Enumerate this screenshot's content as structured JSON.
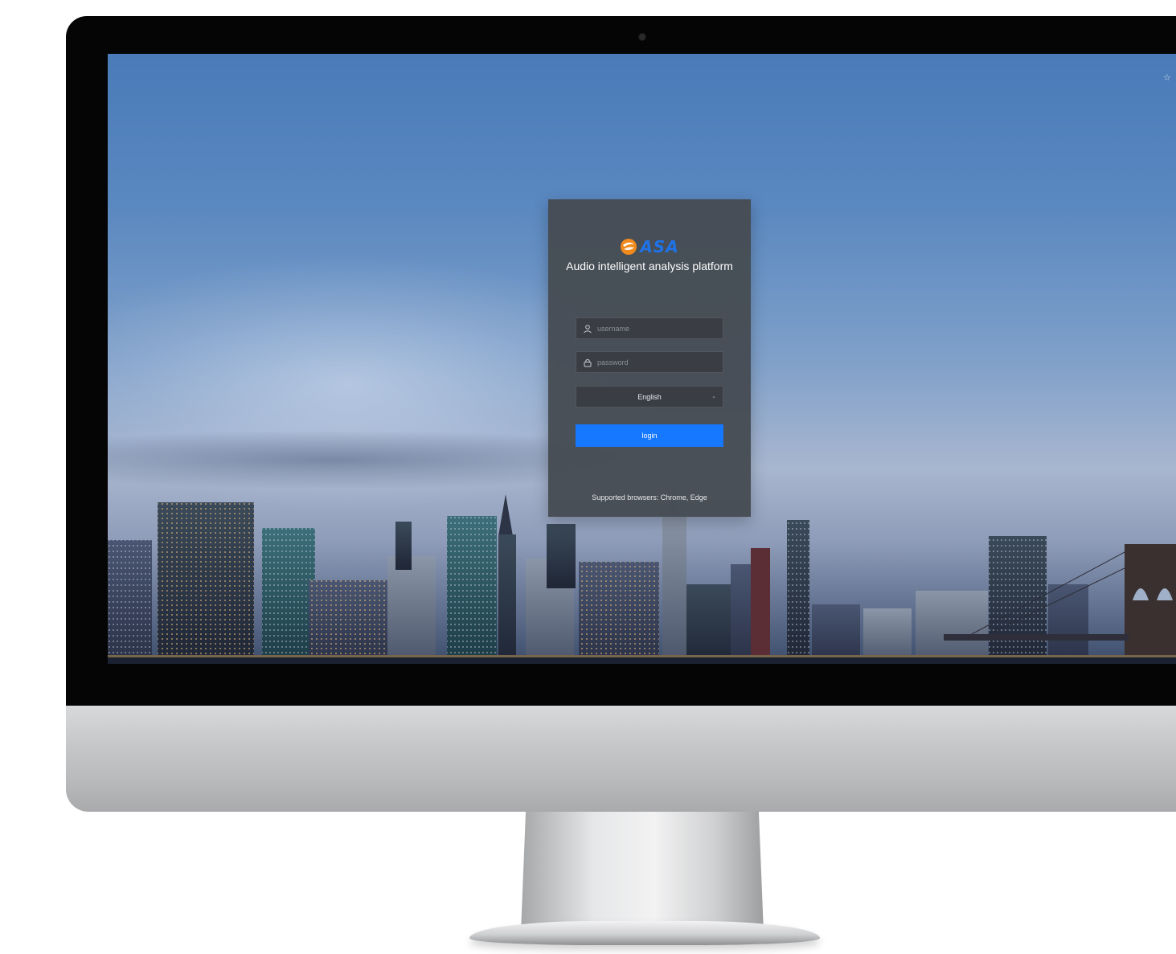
{
  "login": {
    "logo_text": "ASA",
    "title": "Audio intelligent analysis platform",
    "username_placeholder": "username",
    "password_placeholder": "password",
    "language_selected": "English",
    "login_button": "login",
    "supported_browsers": "Supported browsers: Chrome, Edge"
  },
  "icons": {
    "logo": "asa-logo-icon",
    "user": "user-icon",
    "lock": "lock-icon",
    "dropdown": "chevron-down-icon",
    "corner": "settings-icon"
  },
  "colors": {
    "accent": "#1677ff",
    "logo_blue": "#1e73e8",
    "logo_orange": "#f08a1c",
    "card_bg": "#464c54",
    "input_bg": "#3a3e44"
  }
}
